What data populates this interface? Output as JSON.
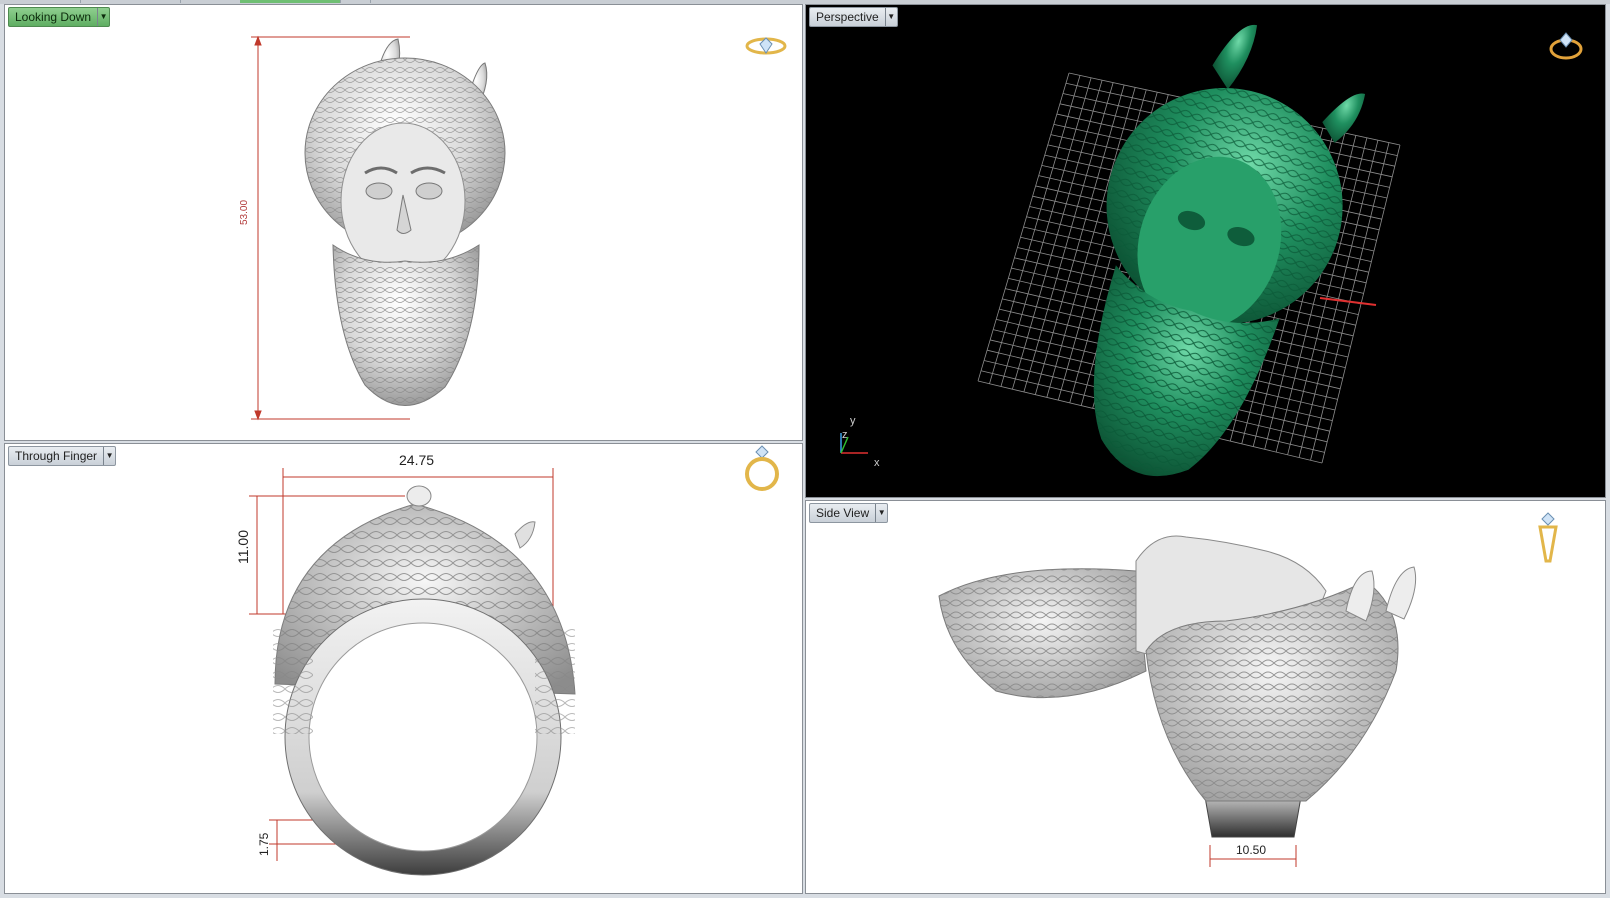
{
  "viewports": {
    "looking_down": {
      "title": "Looking Down",
      "dimension_height": "53.00"
    },
    "perspective": {
      "title": "Perspective",
      "axis_labels": {
        "y": "y",
        "z": "z",
        "x": "x"
      }
    },
    "through_finger": {
      "title": "Through Finger",
      "dimension_width": "24.75",
      "dimension_height": "11.00",
      "dimension_band": "1.75"
    },
    "side_view": {
      "title": "Side View",
      "dimension_width": "10.50"
    }
  },
  "icons": {
    "looking_down": "ring-top-view-icon",
    "perspective": "ring-perspective-icon",
    "through_finger": "ring-front-view-icon",
    "side_view": "ring-side-view-icon",
    "dropdown": "chevron-down-icon"
  },
  "colors": {
    "active_tab": "#6fbf73",
    "dimension": "#c0392b",
    "model_render_green": "#1f8f5f",
    "grid": "#9a9a9a",
    "gold": "#e2b64a"
  }
}
